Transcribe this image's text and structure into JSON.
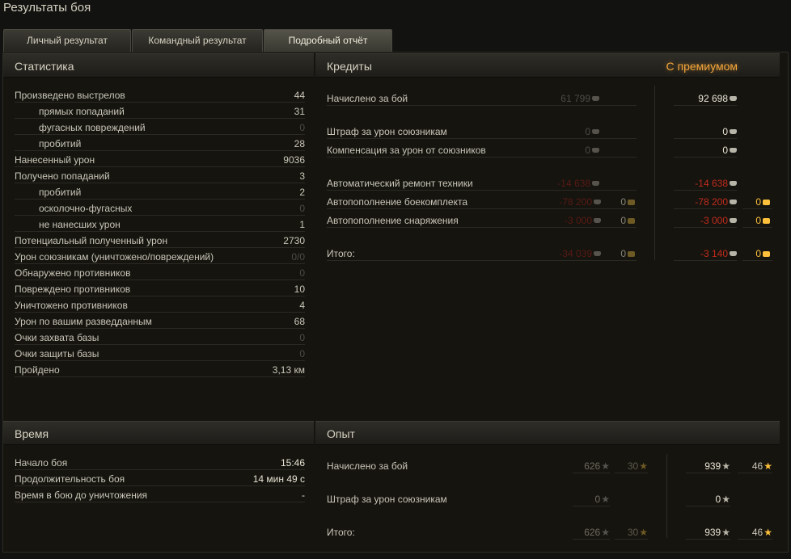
{
  "window": {
    "title": "Результаты боя"
  },
  "tabs": [
    {
      "label": "Личный результат"
    },
    {
      "label": "Командный результат"
    },
    {
      "label": "Подробный отчёт"
    }
  ],
  "stats": {
    "title": "Статистика",
    "rows": [
      {
        "label": "Произведено выстрелов",
        "value": "44"
      },
      {
        "label": "прямых попаданий",
        "value": "31"
      },
      {
        "label": "фугасных повреждений",
        "value": "0"
      },
      {
        "label": "пробитий",
        "value": "28"
      },
      {
        "label": "Нанесенный урон",
        "value": "9036"
      },
      {
        "label": "Получено попаданий",
        "value": "3"
      },
      {
        "label": "пробитий",
        "value": "2"
      },
      {
        "label": "осколочно-фугасных",
        "value": "0"
      },
      {
        "label": "не нанесших урон",
        "value": "1"
      },
      {
        "label": "Потенциальный полученный урон",
        "value": "2730"
      },
      {
        "label": "Урон союзникам (уничтожено/повреждений)",
        "value": "0/0"
      },
      {
        "label": "Обнаружено противников",
        "value": "0"
      },
      {
        "label": "Повреждено противников",
        "value": "10"
      },
      {
        "label": "Уничтожено противников",
        "value": "4"
      },
      {
        "label": "Урон по вашим разведданным",
        "value": "68"
      },
      {
        "label": "Очки захвата базы",
        "value": "0"
      },
      {
        "label": "Очки защиты базы",
        "value": "0"
      },
      {
        "label": "Пройдено",
        "value": "3,13 км"
      }
    ]
  },
  "credits": {
    "title": "Кредиты",
    "premium_label": "С премиумом",
    "rows": [
      {
        "label": "Начислено за бой",
        "base": "61 799",
        "prem": "92 698"
      },
      {
        "label": "Штраф за урон союзникам",
        "base": "0",
        "prem": "0"
      },
      {
        "label": "Компенсация за урон от союзников",
        "base": "0",
        "prem": "0"
      },
      {
        "label": "Автоматический ремонт техники",
        "base": "-14 638",
        "prem": "-14 638"
      },
      {
        "label": "Автопополнение боекомплекта",
        "base": "-78 200",
        "base_gold": "0",
        "prem": "-78 200",
        "prem_gold": "0"
      },
      {
        "label": "Автопополнение снаряжения",
        "base": "-3 000",
        "base_gold": "0",
        "prem": "-3 000",
        "prem_gold": "0"
      },
      {
        "label": "Итого:",
        "base": "-34 039",
        "base_gold": "0",
        "prem": "-3 140",
        "prem_gold": "0"
      }
    ]
  },
  "time": {
    "title": "Время",
    "rows": [
      {
        "label": "Начало боя",
        "value": "15:46"
      },
      {
        "label": "Продолжительность боя",
        "value": "14 мин 49 с"
      },
      {
        "label": "Время в бою до уничтожения",
        "value": "-"
      }
    ]
  },
  "experience": {
    "title": "Опыт",
    "rows": [
      {
        "label": "Начислено за бой",
        "base": "626",
        "base_free": "30",
        "prem": "939",
        "prem_free": "46"
      },
      {
        "label": "Штраф за урон союзникам",
        "base": "0",
        "prem": "0"
      },
      {
        "label": "Итого:",
        "base": "626",
        "base_free": "30",
        "prem": "939",
        "prem_free": "46"
      }
    ]
  },
  "colors": {
    "premium": "#f3a53a",
    "negative": "#c22b1c",
    "gold": "#ffc13c"
  },
  "icons": {
    "credits": "credit-coin-icon",
    "gold": "gold-coin-icon",
    "experience": "experience-star-icon",
    "free_experience": "free-experience-star-icon"
  }
}
